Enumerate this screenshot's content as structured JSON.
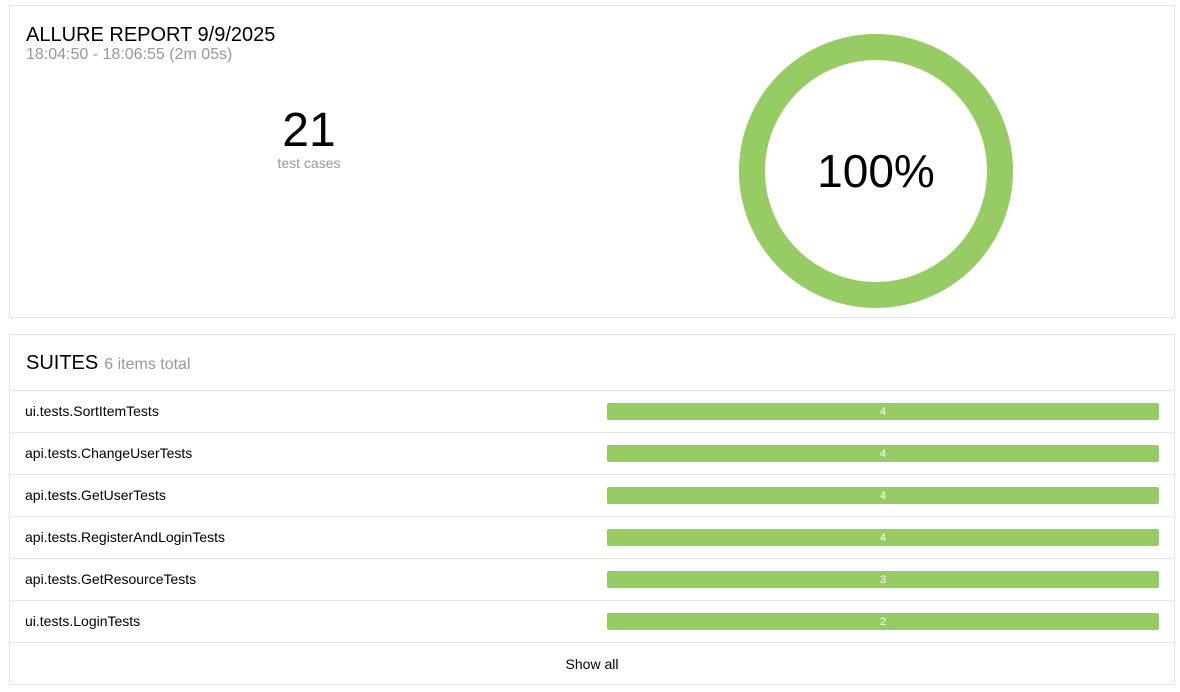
{
  "summary": {
    "title": "ALLURE REPORT 9/9/2025",
    "time_range": "18:04:50 - 18:06:55 (2m 05s)",
    "test_cases_count": "21",
    "test_cases_label": "test cases",
    "pass_rate_text": "100%",
    "pass_rate_fraction": 1.0,
    "colors": {
      "passed": "#97cc64",
      "muted_text": "#999999"
    }
  },
  "suites": {
    "title": "SUITES",
    "total_text": "6 items total",
    "items": [
      {
        "name": "ui.tests.SortItemTests",
        "count": "4"
      },
      {
        "name": "api.tests.ChangeUserTests",
        "count": "4"
      },
      {
        "name": "api.tests.GetUserTests",
        "count": "4"
      },
      {
        "name": "api.tests.RegisterAndLoginTests",
        "count": "4"
      },
      {
        "name": "api.tests.GetResourceTests",
        "count": "3"
      },
      {
        "name": "ui.tests.LoginTests",
        "count": "2"
      }
    ],
    "show_all_label": "Show all"
  }
}
